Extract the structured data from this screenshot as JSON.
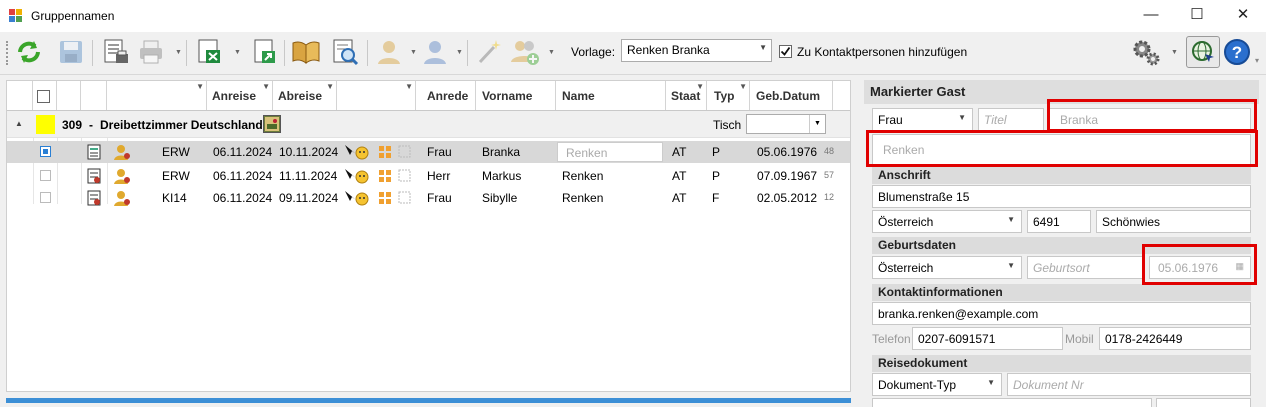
{
  "window": {
    "title": "Gruppennamen",
    "minimize": "—",
    "maximize": "☐",
    "close": "✕"
  },
  "toolbar": {
    "vorlage_label": "Vorlage:",
    "vorlage_value": "Renken Branka",
    "kontakt_label": "Zu Kontaktpersonen hinzufügen",
    "kontakt_checked": true
  },
  "grid": {
    "headers": {
      "anreise": "Anreise",
      "abreise": "Abreise",
      "anrede": "Anrede",
      "vorname": "Vorname",
      "name": "Name",
      "staat": "Staat",
      "typ": "Typ",
      "geb": "Geb.Datum"
    },
    "group": {
      "number": "309",
      "dash": "-",
      "name": "Dreibettzimmer Deutschland",
      "tisch_label": "Tisch",
      "tisch_value": ""
    },
    "rows": [
      {
        "kat": "ERW",
        "anreise": "06.11.2024",
        "abreise": "10.11.2024",
        "anrede": "Frau",
        "vorname": "Branka",
        "name": "Renken",
        "staat": "AT",
        "typ": "P",
        "geb": "05.06.1976",
        "num": "48"
      },
      {
        "kat": "ERW",
        "anreise": "06.11.2024",
        "abreise": "11.11.2024",
        "anrede": "Herr",
        "vorname": "Markus",
        "name": "Renken",
        "staat": "AT",
        "typ": "P",
        "geb": "07.09.1967",
        "num": "57"
      },
      {
        "kat": "KI14",
        "anreise": "06.11.2024",
        "abreise": "09.11.2024",
        "anrede": "Frau",
        "vorname": "Sibylle",
        "name": "Renken",
        "staat": "AT",
        "typ": "F",
        "geb": "02.05.2012",
        "num": "12"
      }
    ]
  },
  "guest": {
    "title": "Markierter Gast",
    "anrede": "Frau",
    "titel_ph": "Titel",
    "vorname": "Branka",
    "nachname": "Renken",
    "anschrift_label": "Anschrift",
    "strasse": "Blumenstraße 15",
    "land": "Österreich",
    "plz": "6491",
    "ort": "Schönwies",
    "geburt_label": "Geburtsdaten",
    "geburt_land": "Österreich",
    "geburtsort_ph": "Geburtsort",
    "geburtsdatum": "05.06.1976",
    "kontakt_label": "Kontaktinformationen",
    "email": "branka.renken@example.com",
    "telefon_label": "Telefon",
    "telefon": "0207-6091571",
    "mobil_label": "Mobil",
    "mobil": "0178-2426449",
    "reise_label": "Reisedokument",
    "dok_typ": "Dokument-Typ",
    "dok_nr_ph": "Dokument Nr"
  }
}
